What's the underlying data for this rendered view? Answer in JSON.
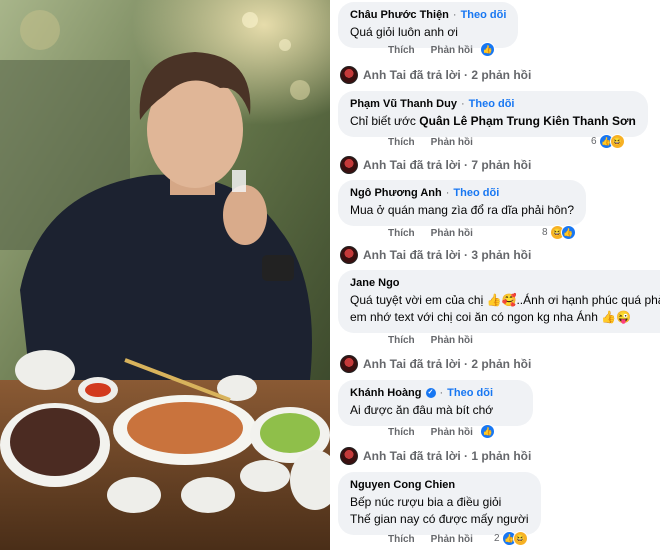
{
  "comments": [
    {
      "author": "Châu Phước Thiện",
      "follow": "Theo dõi",
      "lines": [
        "Quá giỏi luôn anh ơi"
      ],
      "like": "Thích",
      "reply": "Phản hồi",
      "reaction_count": ""
    },
    {
      "author": "Phạm Vũ Thanh Duy",
      "follow": "Theo dõi",
      "lines_prefix": "Chỉ biết ước",
      "lines_tag": "Quân Lê Phạm Trung Kiên Thanh Sơn",
      "like": "Thích",
      "reply": "Phản hồi",
      "reaction_count": "6"
    },
    {
      "author": "Ngô Phương Anh",
      "follow": "Theo dõi",
      "lines": [
        "Mua ở quán mang zìa đổ ra dĩa phải hôn?"
      ],
      "like": "Thích",
      "reply": "Phản hồi",
      "reaction_count": "8"
    },
    {
      "author": "Jane Ngo",
      "follow": "",
      "lines": [
        "Quá tuyệt vời em của chị 👍🥰..Ánh ơi hạnh phúc quá phả",
        "em nhớ text với chị coi ăn có ngon kg nha Ánh 👍😜"
      ],
      "like": "Thích",
      "reply": "Phản hồi",
      "reaction_count": ""
    },
    {
      "author": "Khánh Hoàng",
      "follow": "Theo dõi",
      "lines": [
        "Ai được ăn đâu mà bít chớ"
      ],
      "like": "Thích",
      "reply": "Phản hồi",
      "reaction_count": ""
    },
    {
      "author": "Nguyen Cong Chien",
      "follow": "",
      "lines": [
        "Bếp núc rượu bia a điều giỏi",
        "Thế gian nay có được mấy người"
      ],
      "like": "Thích",
      "reply": "Phản hồi",
      "reaction_count": "2"
    }
  ],
  "replies": [
    "Anh Tai đã trả lời · 2 phản hồi",
    "Anh Tai đã trả lời · 7 phản hồi",
    "Anh Tai đã trả lời · 3 phản hồi",
    "Anh Tai đã trả lời · 2 phản hồi",
    "Anh Tai đã trả lời · 1 phản hồi"
  ],
  "icons": {
    "like": "👍",
    "haha": "😆",
    "love": "❤",
    "verified": "✓",
    "reply_arrow": "↳"
  },
  "colors": {
    "bubble": "#f0f2f5",
    "follow": "#1877f2",
    "muted": "#65676b",
    "text": "#050505"
  }
}
